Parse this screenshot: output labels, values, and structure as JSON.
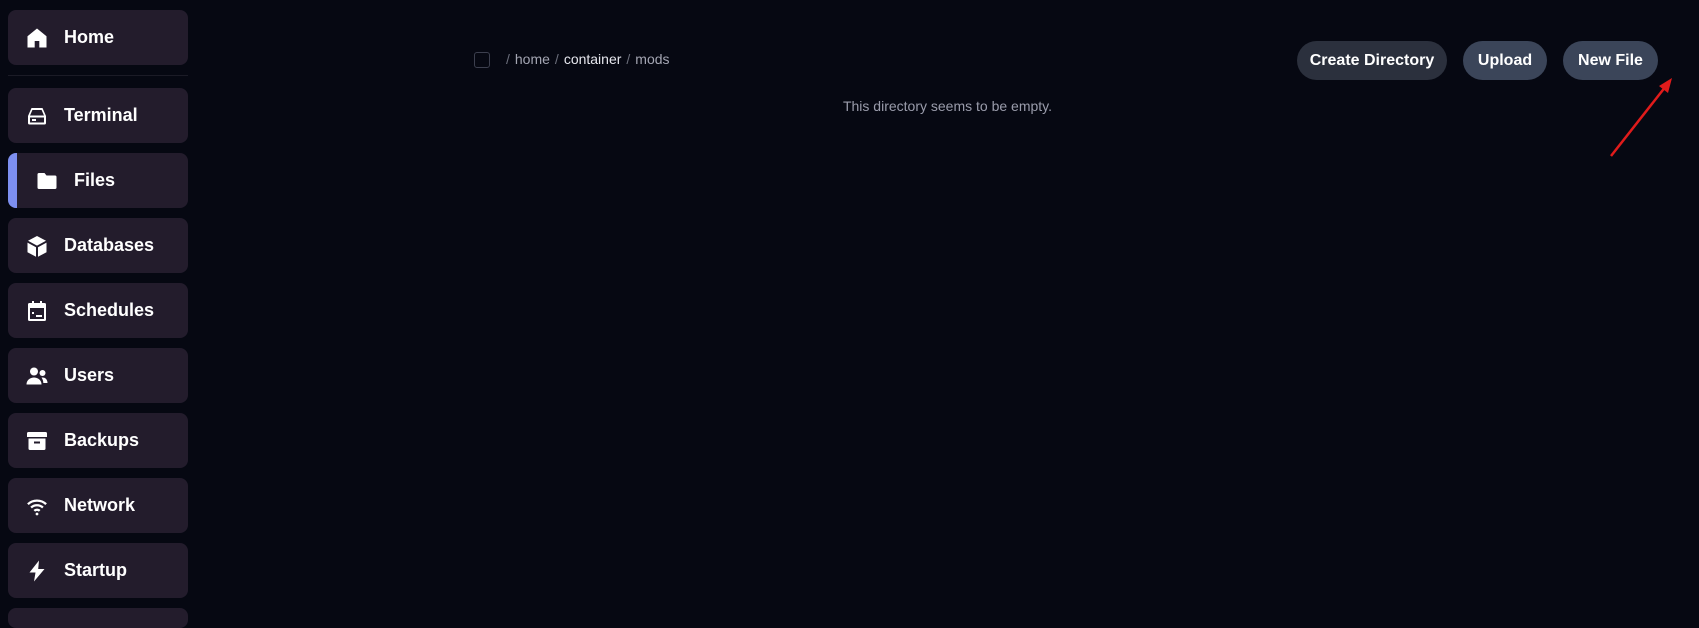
{
  "sidebar": {
    "items": [
      {
        "label": "Home",
        "icon": "home-icon",
        "active": false
      },
      {
        "label": "Terminal",
        "icon": "terminal-icon",
        "active": false
      },
      {
        "label": "Files",
        "icon": "folder-icon",
        "active": true
      },
      {
        "label": "Databases",
        "icon": "database-icon",
        "active": false
      },
      {
        "label": "Schedules",
        "icon": "calendar-icon",
        "active": false
      },
      {
        "label": "Users",
        "icon": "users-icon",
        "active": false
      },
      {
        "label": "Backups",
        "icon": "archive-icon",
        "active": false
      },
      {
        "label": "Network",
        "icon": "wifi-icon",
        "active": false
      },
      {
        "label": "Startup",
        "icon": "bolt-icon",
        "active": false
      }
    ],
    "active_accent": "#7d8ff0"
  },
  "files": {
    "breadcrumb": [
      {
        "label": "home",
        "current": false
      },
      {
        "label": "container",
        "current": false
      },
      {
        "label": "mods",
        "current": true
      }
    ],
    "breadcrumb_separator": "/",
    "empty_message": "This directory seems to be empty.",
    "actions": {
      "create_directory": "Create Directory",
      "upload": "Upload",
      "new_file": "New File"
    }
  },
  "colors": {
    "background": "#060812",
    "nav_item_bg": "#231c2c",
    "annotation": "#e01b1b"
  }
}
